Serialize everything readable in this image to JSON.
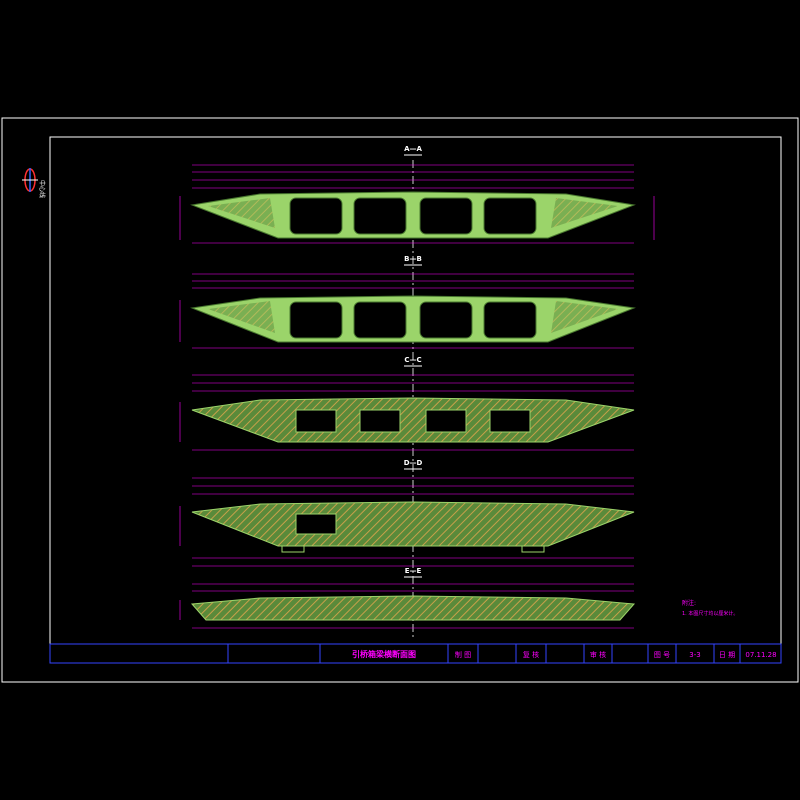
{
  "sections": [
    {
      "label": "A—A"
    },
    {
      "label": "B—B"
    },
    {
      "label": "C—C"
    },
    {
      "label": "D—D"
    },
    {
      "label": "E—E"
    }
  ],
  "north_mark": {
    "text": "中心线"
  },
  "note": {
    "title": "附注:",
    "line1": "1. 本图尺寸均以厘米计。"
  },
  "title_block": {
    "drawing_title": "引桥箱梁横断面图",
    "draw_label": "制 图",
    "check_label": "复 核",
    "review_label": "审 核",
    "number_label": "图 号",
    "number_value": "3-3",
    "date_label": "日 期",
    "date_value": "07.11.28"
  },
  "colors": {
    "background": "#000000",
    "frame": "#ffffff",
    "concrete": "#9bd46a",
    "hatch": "#c8a04a",
    "dims": "#ff00ff",
    "center": "#ffffff",
    "titleblock_line": "#3344ff",
    "titleblock_text": "#ff00ff"
  }
}
